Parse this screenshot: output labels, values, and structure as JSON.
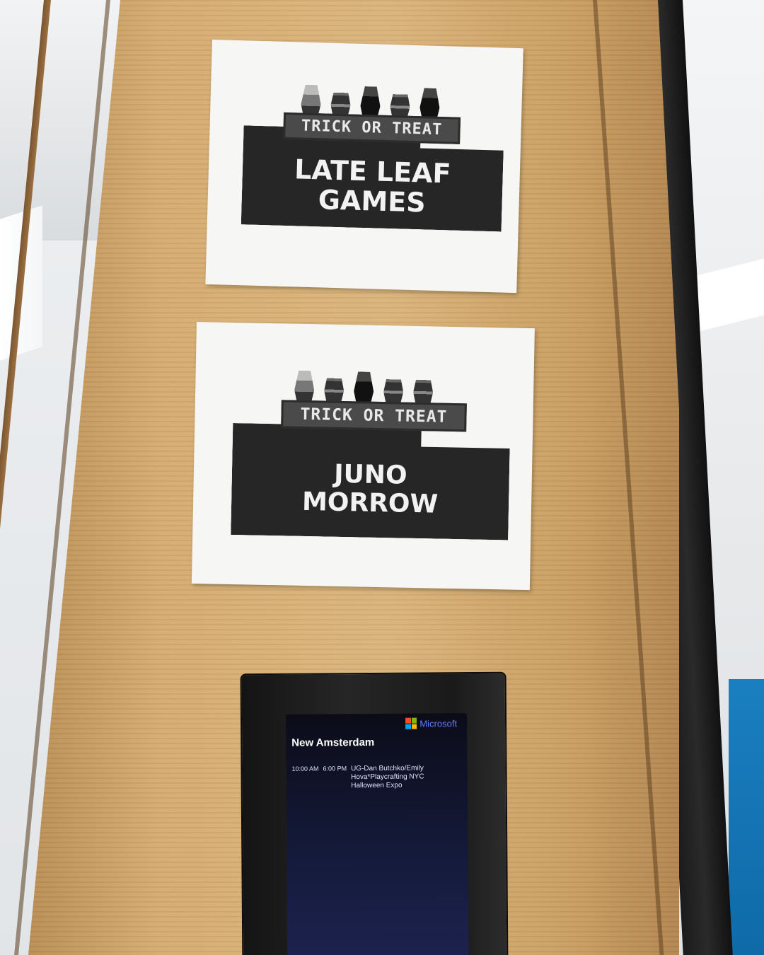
{
  "posters": [
    {
      "header": "TRICK OR TREAT",
      "name_line1": "LATE LEAF",
      "name_line2": "GAMES"
    },
    {
      "header": "TRICK OR TREAT",
      "name_line1": "JUNO",
      "name_line2": "MORROW"
    }
  ],
  "display": {
    "brand": "Microsoft",
    "room": "New Amsterdam",
    "event": {
      "start": "10:00 AM",
      "end": "6:00 PM",
      "title_line1": "UG-Dan Butchko/Emily",
      "title_line2": "Hova*Playcrafting NYC",
      "title_line3": "Halloween Expo"
    },
    "logo_colors": [
      "#f25022",
      "#7fba00",
      "#00a4ef",
      "#ffb900"
    ]
  }
}
